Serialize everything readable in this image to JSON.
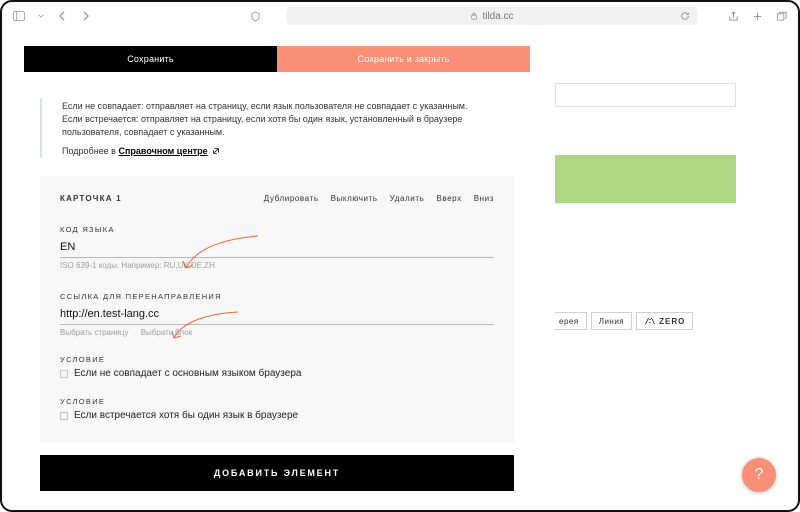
{
  "browser": {
    "url": "tilda.cc"
  },
  "actions": {
    "save": "Сохранить",
    "save_close": "Сохранить и закрыть"
  },
  "info": {
    "line1": "Если не совпадает: отправляет на страницу, если язык пользователя не совпадает с указанным.",
    "line2": "Если встречается: отправляет на страницу, если хотя бы один язык, установленный в браузере пользователя, совпадает с указанным.",
    "more_prefix": "Подробнее в ",
    "more_link": "Справочном центре"
  },
  "card": {
    "title": "КАРТОЧКА 1",
    "actions": [
      "Дублировать",
      "Выключить",
      "Удалить",
      "Вверх",
      "Вниз"
    ],
    "lang": {
      "label": "КОД ЯЗЫКА",
      "value": "EN",
      "hint": "ISO 639-1 коды. Например: RU,UK,DE,ZH"
    },
    "redirect": {
      "label": "ССЫЛКА ДЛЯ ПЕРЕНАПРАВЛЕНИЯ",
      "value": "http://en.test-lang.cc",
      "hint_page": "Выбрать страницу",
      "hint_block": "Выбрать блок"
    },
    "cond_label": "УСЛОВИЕ",
    "cond1": "Если не совпадает с основным языком браузера",
    "cond2": "Если встречается хотя бы один язык в браузере"
  },
  "add_button": "ДОБАВИТЬ ЭЛЕМЕНТ",
  "toolbar": {
    "gallery_suffix": "ерея",
    "line": "Линия",
    "zero": "ZERO"
  },
  "fab": "?"
}
